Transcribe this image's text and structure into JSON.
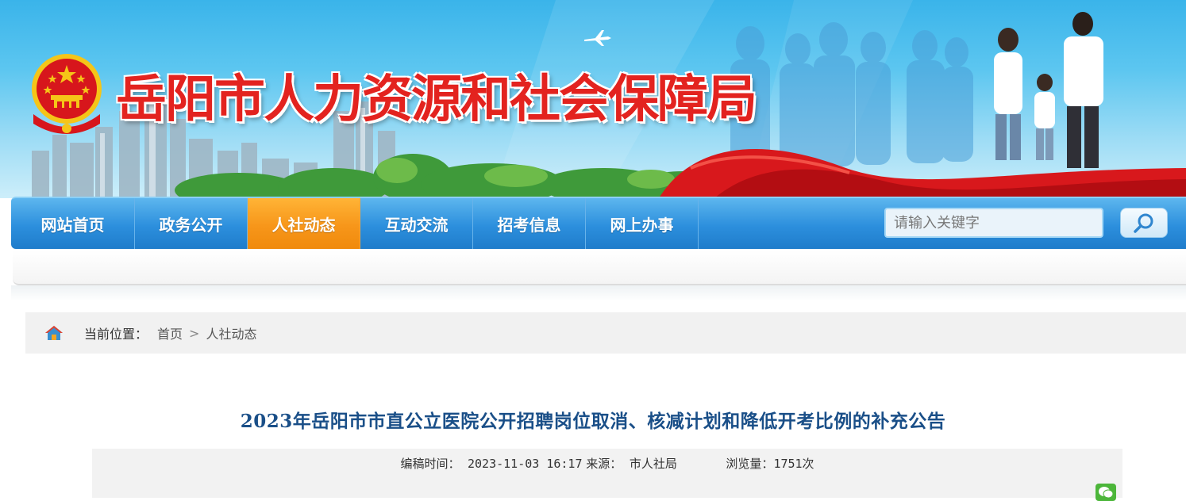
{
  "banner": {
    "site_title": "岳阳市人力资源和社会保障局"
  },
  "nav": {
    "items": [
      {
        "label": "网站首页"
      },
      {
        "label": "政务公开"
      },
      {
        "label": "人社动态",
        "active": true
      },
      {
        "label": "互动交流"
      },
      {
        "label": "招考信息"
      },
      {
        "label": "网上办事"
      }
    ],
    "search_placeholder": "请输入关键字"
  },
  "breadcrumb": {
    "label": "当前位置：",
    "items": [
      "首页",
      "人社动态"
    ],
    "separator": ">"
  },
  "article": {
    "title": "2023年岳阳市市直公立医院公开招聘岗位取消、核减计划和降低开考比例的补充公告",
    "meta": {
      "time_label": "编稿时间：",
      "time_value": "2023-11-03 16:17",
      "source_label": "来源：",
      "source_value": "市人社局",
      "views_label": "浏览量：",
      "views_value": "1751次"
    }
  },
  "colors": {
    "title_red": "#e3231f",
    "nav_blue": "#2c8fdd",
    "nav_active_orange": "#f7961a",
    "article_title_blue": "#1a4f88"
  }
}
